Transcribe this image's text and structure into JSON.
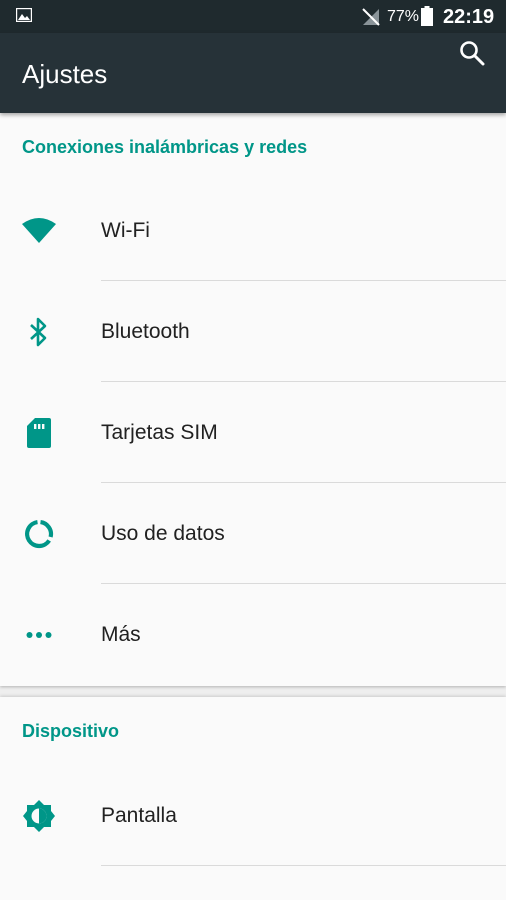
{
  "status_bar": {
    "battery_percent": "77%",
    "time": "22:19"
  },
  "app_bar": {
    "title": "Ajustes",
    "search_icon": "search-icon"
  },
  "sections": [
    {
      "title": "Conexiones inalámbricas y redes",
      "items": [
        {
          "label": "Wi-Fi",
          "icon": "wifi-icon"
        },
        {
          "label": "Bluetooth",
          "icon": "bluetooth-icon"
        },
        {
          "label": "Tarjetas SIM",
          "icon": "sim-card-icon"
        },
        {
          "label": "Uso de datos",
          "icon": "data-usage-icon"
        },
        {
          "label": "Más",
          "icon": "more-dots-icon"
        }
      ]
    },
    {
      "title": "Dispositivo",
      "items": [
        {
          "label": "Pantalla",
          "icon": "brightness-icon"
        }
      ]
    }
  ],
  "colors": {
    "accent": "#009688",
    "app_bar": "#263238",
    "status_bar": "#1f2a2e",
    "text_primary": "#212121"
  }
}
